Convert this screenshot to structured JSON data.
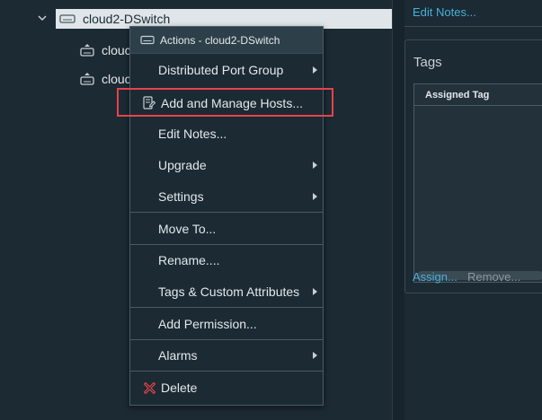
{
  "tree": {
    "selected_label": "cloud2-DSwitch",
    "child_1_label": "clouc",
    "child_2_label": "clouc"
  },
  "context_menu": {
    "header": "Actions - cloud2-DSwitch",
    "items": [
      {
        "label": "Distributed Port Group",
        "submenu": true
      },
      {
        "label": "Add and Manage Hosts...",
        "submenu": false,
        "icon": "add-hosts-icon"
      },
      {
        "label": "Edit Notes...",
        "submenu": false
      },
      {
        "label": "Upgrade",
        "submenu": true
      },
      {
        "label": "Settings",
        "submenu": true
      },
      {
        "label": "Move To...",
        "submenu": false
      },
      {
        "label": "Rename....",
        "submenu": false
      },
      {
        "label": "Tags & Custom Attributes",
        "submenu": true
      },
      {
        "label": "Add Permission...",
        "submenu": false
      },
      {
        "label": "Alarms",
        "submenu": true
      },
      {
        "label": "Delete",
        "submenu": false,
        "icon": "delete-icon"
      }
    ]
  },
  "right_panel": {
    "edit_notes_link": "Edit Notes...",
    "tags_title": "Tags",
    "grid_column": "Assigned Tag",
    "assign_link": "Assign...",
    "remove_link": "Remove..."
  },
  "colors": {
    "background": "#1b2a33",
    "link": "#49afd9",
    "highlight": "#e8434a",
    "delete_icon": "#e8434a"
  }
}
